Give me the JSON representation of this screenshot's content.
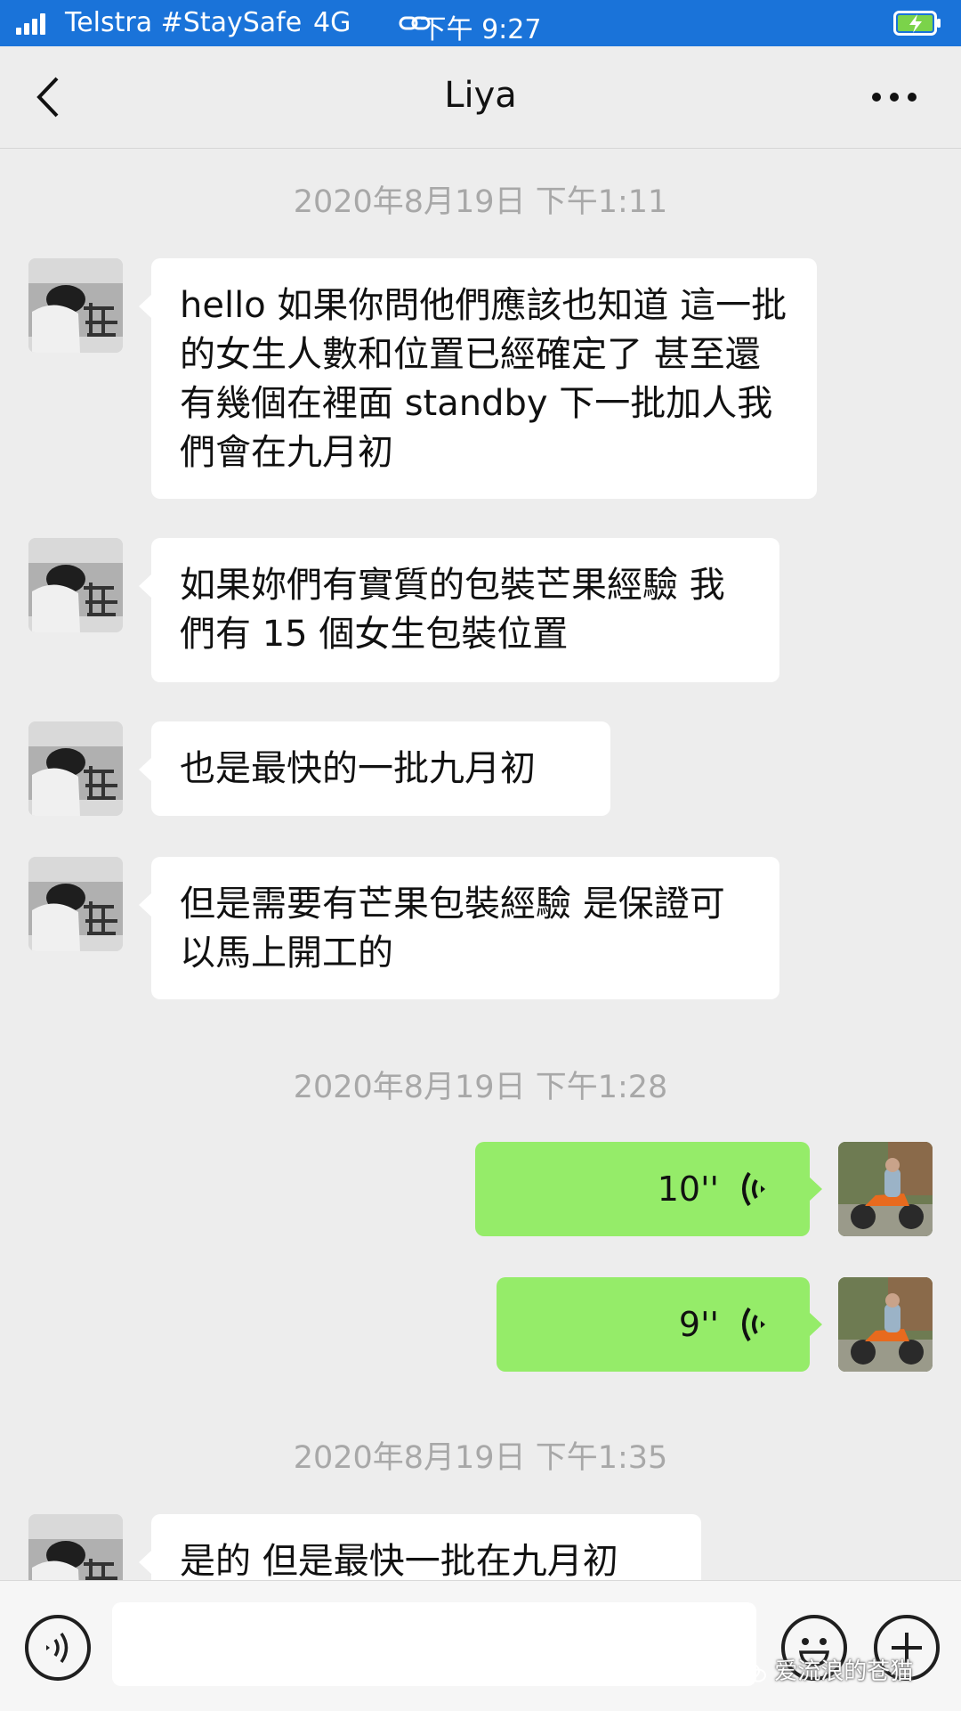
{
  "status_bar": {
    "carrier": "Telstra #StaySafe",
    "network": "4G",
    "time": "下午 9:27"
  },
  "header": {
    "title": "Liya"
  },
  "messages": {
    "timestamp_1": "2020年8月19日 下午1:11",
    "msg_1": "hello 如果你問他們應該也知道 這一批的女生人數和位置已經確定了 甚至還有幾個在裡面 standby 下一批加人我們會在九月初",
    "msg_2": "如果妳們有實質的包裝芒果經驗 我們有 15 個女生包裝位置",
    "msg_3": "也是最快的一批九月初",
    "msg_4": "但是需要有芒果包裝經驗 是保證可以馬上開工的",
    "timestamp_2": "2020年8月19日 下午1:28",
    "voice_1_duration": "10''",
    "voice_2_duration": "9''",
    "timestamp_3": "2020年8月19日 下午1:35",
    "msg_5": "是的 但是最快一批在九月初"
  },
  "watermark": "爱流浪的苍猫",
  "colors": {
    "status_bar": "#1a73d9",
    "background": "#ededed",
    "outgoing_bubble": "#95ec69",
    "incoming_bubble": "#ffffff"
  }
}
